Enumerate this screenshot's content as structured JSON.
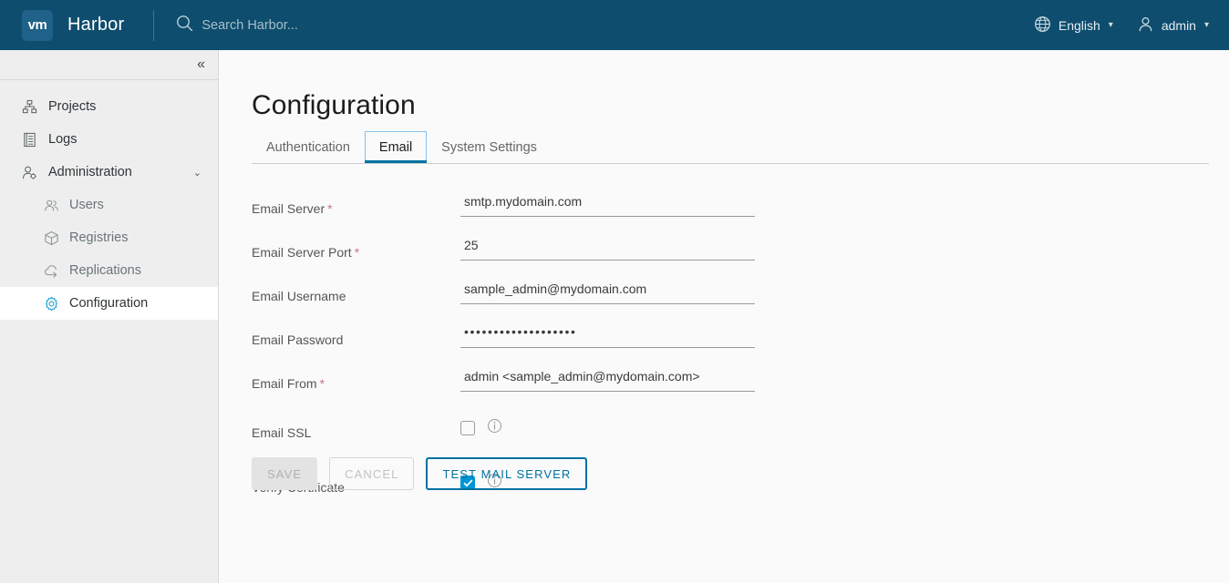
{
  "header": {
    "logo_text": "vm",
    "brand": "Harbor",
    "search_placeholder": "Search Harbor...",
    "search_value": "",
    "language": "English",
    "user": "admin",
    "icons": {
      "search": "search-icon",
      "globe": "globe-icon",
      "user": "user-icon"
    }
  },
  "sidebar": {
    "collapse_label": "«",
    "items": [
      {
        "label": "Projects",
        "icon": "projects-icon",
        "level": "top",
        "active": false
      },
      {
        "label": "Logs",
        "icon": "logs-icon",
        "level": "top",
        "active": false
      },
      {
        "label": "Administration",
        "icon": "administration-icon",
        "level": "top",
        "active": false,
        "caret": "⌄"
      },
      {
        "label": "Users",
        "icon": "users-icon",
        "level": "sub",
        "active": false
      },
      {
        "label": "Registries",
        "icon": "registries-icon",
        "level": "sub",
        "active": false
      },
      {
        "label": "Replications",
        "icon": "replications-icon",
        "level": "sub",
        "active": false
      },
      {
        "label": "Configuration",
        "icon": "configuration-gear-icon",
        "level": "sub",
        "active": true
      }
    ]
  },
  "main": {
    "title": "Configuration",
    "tabs": [
      {
        "label": "Authentication",
        "active": false
      },
      {
        "label": "Email",
        "active": true
      },
      {
        "label": "System Settings",
        "active": false
      }
    ],
    "form": {
      "email_server": {
        "label": "Email Server",
        "required": "*",
        "value": "smtp.mydomain.com",
        "placeholder": ""
      },
      "email_server_port": {
        "label": "Email Server Port",
        "required": "*",
        "value": "25",
        "placeholder": ""
      },
      "email_username": {
        "label": "Email Username",
        "required": "",
        "value": "sample_admin@mydomain.com",
        "placeholder": ""
      },
      "email_password": {
        "label": "Email Password",
        "required": "",
        "value": "•••••••••••••••••••",
        "placeholder": ""
      },
      "email_from": {
        "label": "Email From",
        "required": "*",
        "value": "admin <sample_admin@mydomain.com>",
        "placeholder": ""
      },
      "email_ssl": {
        "label": "Email SSL",
        "checked": false
      },
      "verify_certificate": {
        "label": "Verify Certificate",
        "checked": true
      }
    },
    "buttons": {
      "save": "SAVE",
      "cancel": "CANCEL",
      "test_mail_server": "TEST MAIL SERVER"
    }
  },
  "colors": {
    "header_bg": "#0e4d6d",
    "logo_bg": "#1f6188",
    "sidebar_bg": "#eeeeee",
    "content_bg": "#fafafa",
    "accent": "#0072a3",
    "checkbox_checked": "#0095d3",
    "tab_focus_border": "#89c1ec",
    "required_asterisk": "#c9768a"
  }
}
